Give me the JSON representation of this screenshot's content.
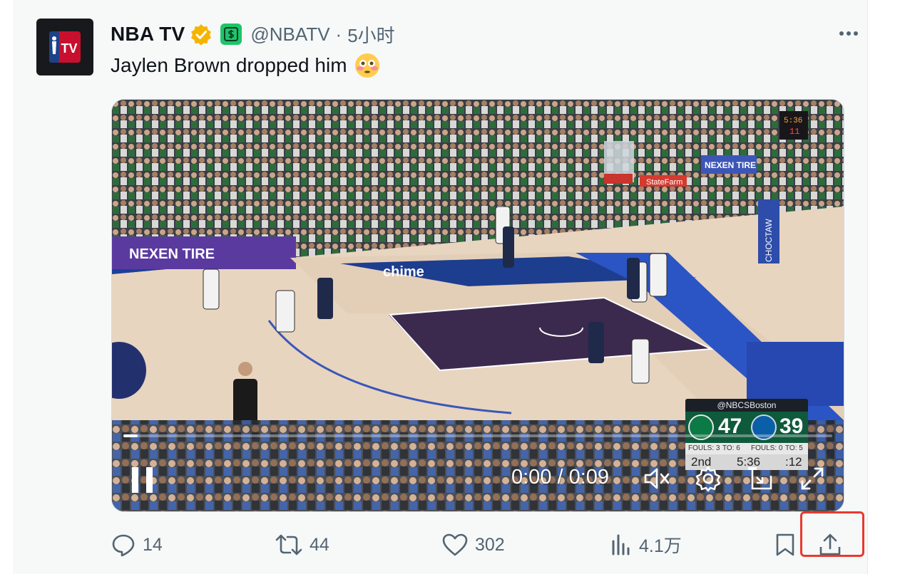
{
  "tweet": {
    "author_name": "NBA TV",
    "handle": "@NBATV",
    "separator": "·",
    "time": "5小时",
    "text": "Jaylen Brown dropped him",
    "emoji": "flushed-face"
  },
  "video": {
    "timecode": "0:00 / 0:09",
    "progress_fraction": 0.02,
    "muted": true,
    "scorebug": {
      "network": "@NBCSBoston",
      "home_score": "47",
      "away_score": "39",
      "home_fouls": "FOULS: 3",
      "home_timeouts": "TO: 6",
      "away_fouls": "FOULS: 0",
      "away_timeouts": "TO: 5",
      "period": "2nd",
      "clock": "5:36",
      "shot_clock": ":12"
    },
    "arena_signs": {
      "sign1": "NEXEN TIRE",
      "sign2": "NEXEN TIRE",
      "sign3": "chime",
      "sign4": "StateFarm",
      "sign5": "CHOCTAW"
    }
  },
  "actions": {
    "replies": "14",
    "retweets": "44",
    "likes": "302",
    "views": "4.1万"
  },
  "colors": {
    "accent_highlight": "#e8392f",
    "verified": "#f5b400",
    "celtics_green": "#0f5a3b"
  }
}
